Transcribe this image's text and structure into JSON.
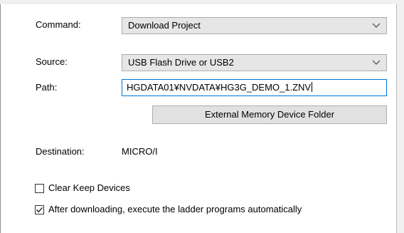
{
  "command": {
    "label": "Command:",
    "value": "Download Project",
    "icon": "chevron-down-icon"
  },
  "source": {
    "label": "Source:",
    "value": "USB Flash Drive or USB2",
    "icon": "chevron-down-icon"
  },
  "path": {
    "label": "Path:",
    "value": "HGDATA01¥NVDATA¥HG3G_DEMO_1.ZNV"
  },
  "folder_button": {
    "label": "External Memory Device Folder"
  },
  "destination": {
    "label": "Destination:",
    "value": "MICRO/I"
  },
  "options": {
    "clear_keep": {
      "label": "Clear Keep Devices",
      "checked": false
    },
    "auto_execute": {
      "label": "After downloading, execute the ladder programs automatically",
      "checked": true
    }
  },
  "colors": {
    "focus_border": "#0078d7",
    "combo_background": "#e6e6e6",
    "button_background": "#e1e1e1"
  }
}
